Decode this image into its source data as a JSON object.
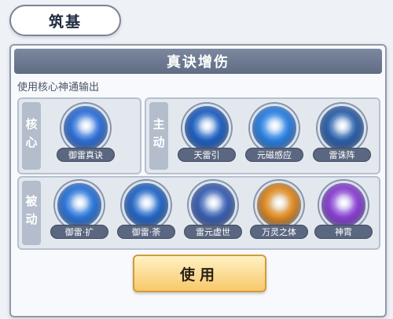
{
  "tab": {
    "label": "筑基"
  },
  "panel": {
    "title": "真诀增伤",
    "description": "使用核心神通输出"
  },
  "groups": {
    "core": {
      "label": "核心",
      "skills": [
        {
          "name": "御雷真诀",
          "color": "#2f6fd6"
        }
      ]
    },
    "active": {
      "label": "主动",
      "skills": [
        {
          "name": "天雷引",
          "color": "#1f5fbf"
        },
        {
          "name": "元磁感应",
          "color": "#2a7fe0"
        },
        {
          "name": "雷诛阵",
          "color": "#2c5fa8"
        }
      ]
    },
    "passive": {
      "label": "被动",
      "skills": [
        {
          "name": "御雷·扩",
          "color": "#2a74d8"
        },
        {
          "name": "御雷·荼",
          "color": "#2466c4"
        },
        {
          "name": "雷元虚世",
          "color": "#3a5fb0"
        },
        {
          "name": "万灵之体",
          "color": "#e08a1e"
        },
        {
          "name": "神霄",
          "color": "#8a3fd0"
        }
      ]
    }
  },
  "use_button": {
    "label": "使用"
  }
}
